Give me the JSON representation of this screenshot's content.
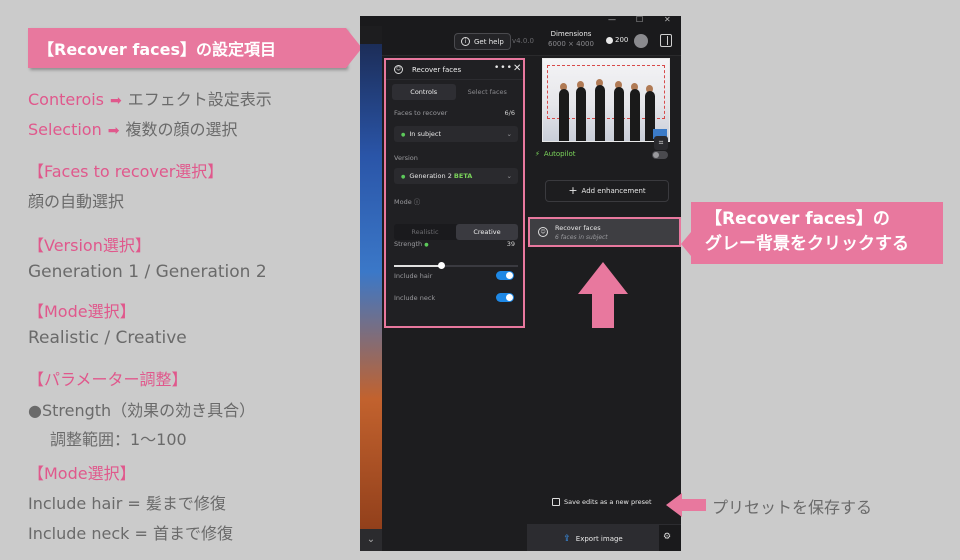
{
  "annotations": {
    "title": "【Recover faces】の設定項目",
    "controls_line": {
      "term": "Conterois",
      "desc": "エフェクト設定表示"
    },
    "selection_line": {
      "term": "Selection",
      "desc": "複数の顔の選択"
    },
    "faces_heading": "【Faces to recover選択】",
    "faces_desc": "顔の自動選択",
    "version_heading": "【Version選択】",
    "version_desc": "Generation 1 / Generation 2",
    "mode_heading": "【Mode選択】",
    "mode_desc": "Realistic / Creative",
    "param_heading": "【パラメーター調整】",
    "param_desc1": "●Strength（効果の効き具合）",
    "param_desc2": "調整範囲：1〜100",
    "mode2_heading": "【Mode選択】",
    "mode2_desc1": "Include hair = 髪まで修復",
    "mode2_desc2": "Include neck = 首まで修復",
    "callout_line1": "【Recover faces】の",
    "callout_line2": "グレー背景をクリックする",
    "preset_note": "プリセットを保存する",
    "accent_color": "#e8789e"
  },
  "topbar": {
    "help_label": "Get help",
    "version": "v4.0.0",
    "dimensions_label": "Dimensions",
    "dimensions_value": "6000 × 4000",
    "credits": "200"
  },
  "recover_panel": {
    "title": "Recover faces",
    "tabs": [
      "Controls",
      "Select faces"
    ],
    "faces_label": "Faces to recover",
    "faces_count": "6/6",
    "faces_value": "In subject",
    "version_label": "Version",
    "version_value": "Generation 2",
    "version_badge": "BETA",
    "mode_label": "Mode ⓘ",
    "mode_options": [
      "Realistic",
      "Creative"
    ],
    "mode_selected": "Creative",
    "strength_label": "Strength",
    "strength_value": "39",
    "include_hair_label": "Include hair",
    "include_hair_on": true,
    "include_neck_label": "Include neck",
    "include_neck_on": true
  },
  "sidebar": {
    "autopilot_label": "Autopilot",
    "autopilot_on": false,
    "add_enhancement_label": "Add enhancement",
    "enhancement_title": "Recover faces",
    "enhancement_subtitle": "6 faces in subject",
    "save_preset_label": "Save edits as a new preset",
    "export_label": "Export image"
  }
}
